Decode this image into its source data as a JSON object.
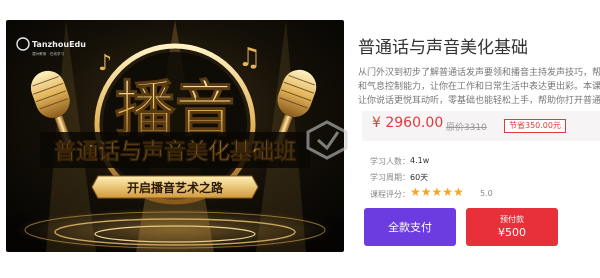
{
  "banner": {
    "brand": "TanzhouEdu",
    "brand_sub": "潭州教育 · 在线学习",
    "heading": "播音",
    "subheading": "普通话与声音美化基础班",
    "ribbon": "开启播音艺术之路"
  },
  "course": {
    "title": "普通话与声音美化基础",
    "description": [
      "从门外汉到初步了解普通话发声要领和播音主持发声技巧，帮助提高普通",
      "和气息控制能力，让你在工作和日常生活中表达更出彩。本课程聚焦普通话与",
      "让你说话更悦耳动听，零基础也能轻松上手，帮助你打开普通话和科学发声的大门。"
    ],
    "price_current": "¥ 2960.00",
    "price_original": "原价3310",
    "saving": "节省350.00元",
    "stats": [
      {
        "label": "学习人数：",
        "value": "4.1w"
      },
      {
        "label": "学习周期：",
        "value": "60天"
      }
    ],
    "rating_label": "课程评分：",
    "stars": "★★★★★",
    "rating_value": "5.0"
  },
  "buttons": {
    "full_pay": "全款支付",
    "deposit_line1": "预付款",
    "deposit_line2": "¥500"
  },
  "colors": {
    "accent_purple": "#6c3ce1",
    "accent_red": "#e8303a",
    "price_red": "#e4393c",
    "star_gold": "#f5a623"
  }
}
